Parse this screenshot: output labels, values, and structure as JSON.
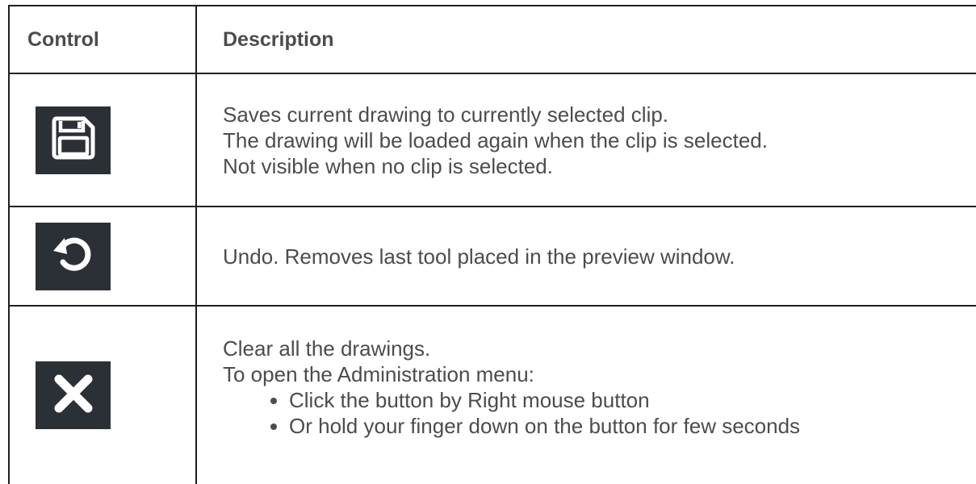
{
  "table": {
    "headers": [
      "Control",
      "Description"
    ],
    "rows": [
      {
        "icon": "save-icon",
        "lines": [
          "Saves current drawing to currently selected clip.",
          "The drawing will be loaded again when the clip is selected.",
          "Not visible when no clip is selected."
        ]
      },
      {
        "icon": "undo-icon",
        "lines": [
          "Undo. Removes last tool placed in the preview window."
        ]
      },
      {
        "icon": "close-icon",
        "lines": [
          "Clear all the drawings.",
          "To open the Administration menu:"
        ],
        "bullets": [
          "Click the button by Right mouse button",
          "Or hold your finger down on the button for few seconds"
        ]
      }
    ]
  },
  "colors": {
    "icon_tile": "#2b2f36",
    "icon_glyph": "#ffffff",
    "text": "#4c4c4c",
    "border": "#1f1f1f"
  }
}
